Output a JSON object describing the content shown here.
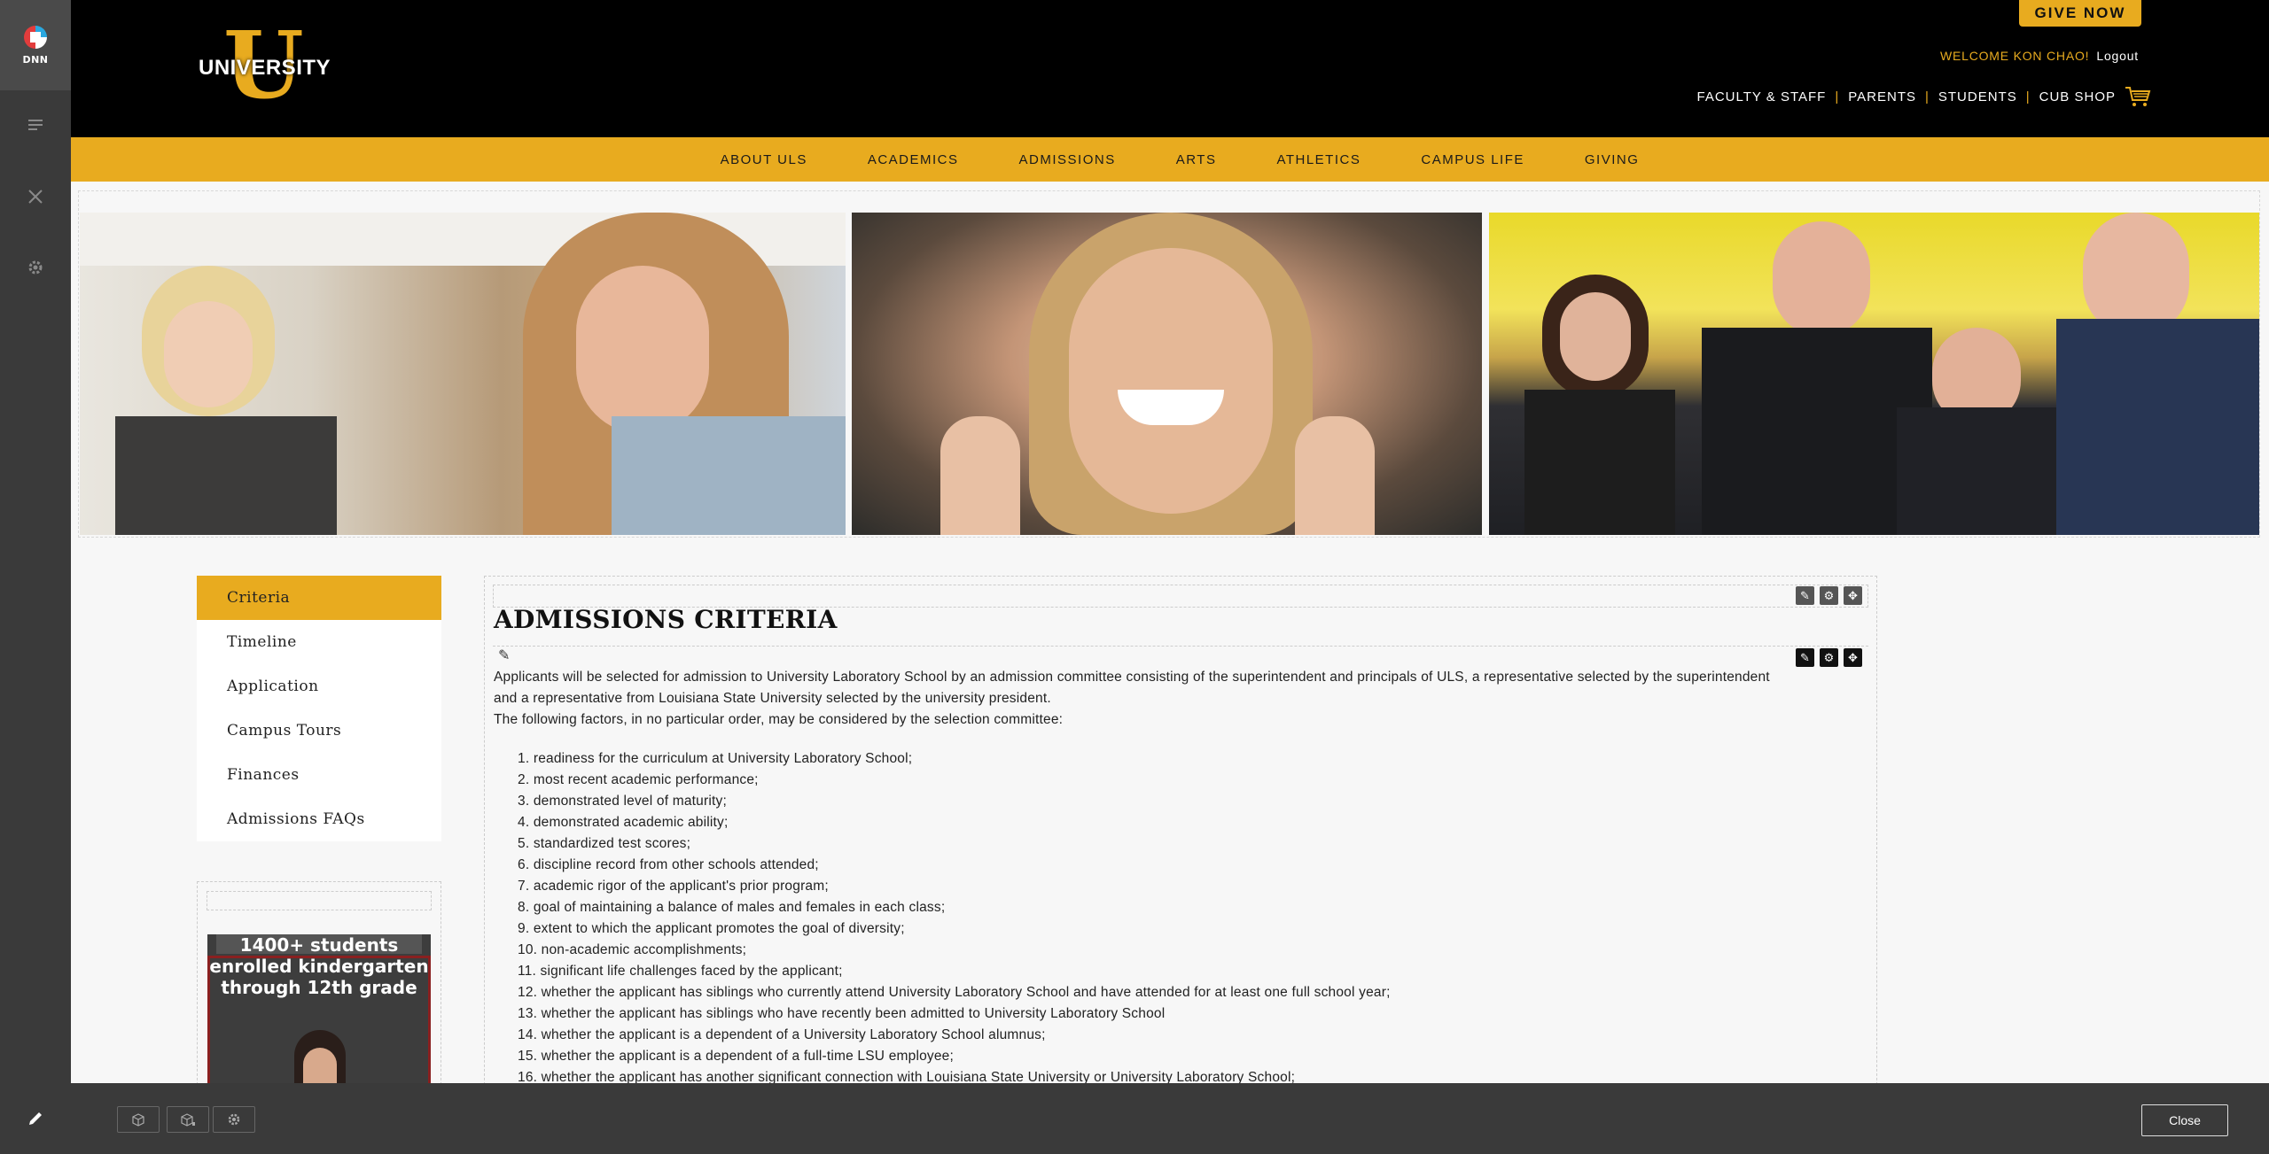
{
  "header": {
    "give_now": "GIVE NOW",
    "welcome": "WELCOME KON CHAO!",
    "logout": "Logout",
    "logo_word": "UNIVERSITY",
    "logo_letter": "U",
    "top_links": [
      "FACULTY & STAFF",
      "PARENTS",
      "STUDENTS",
      "CUB SHOP"
    ]
  },
  "main_nav": [
    "ABOUT ULS",
    "ACADEMICS",
    "ADMISSIONS",
    "ARTS",
    "ATHLETICS",
    "CAMPUS LIFE",
    "GIVING"
  ],
  "left_menu": {
    "items": [
      "Criteria",
      "Timeline",
      "Application",
      "Campus Tours",
      "Finances",
      "Admissions FAQs"
    ],
    "active": "Criteria"
  },
  "promo": {
    "text": "1400+ students enrolled kindergarten through 12th grade"
  },
  "content": {
    "title": "ADMISSIONS CRITERIA",
    "intro_1": "Applicants will be selected for admission to University Laboratory School by an admission committee consisting of the superintendent and principals of ULS, a representative selected by the superintendent and a representative from Louisiana State University selected by the university president.",
    "intro_2": "The following factors, in no particular order, may be considered by the selection committee:",
    "factors": [
      "1. readiness for the curriculum at University Laboratory School;",
      "2. most recent academic performance;",
      "3. demonstrated level of maturity;",
      "4. demonstrated academic ability;",
      "5. standardized test scores;",
      "6. discipline record from other schools attended;",
      "7. academic rigor of the applicant's prior program;",
      "8. goal of maintaining a balance of males and females in each class;",
      "9. extent to which the applicant promotes the goal of diversity;",
      "10. non-academic accomplishments;",
      "11. significant life challenges faced by the applicant;",
      "12. whether the applicant has siblings who currently attend University Laboratory School and have attended for at least one full school year;",
      "13. whether the applicant has siblings who have recently been admitted to University Laboratory School",
      "14. whether the applicant is a dependent of a University Laboratory School alumnus;",
      "15. whether the applicant is a dependent of a full-time LSU employee;",
      "16. whether the applicant has another significant connection with Louisiana State University or University Laboratory School;"
    ]
  },
  "persona_bar": {
    "brand": "DNN"
  },
  "edit_bar": {
    "close": "Close"
  },
  "colors": {
    "gold": "#e8ab1f",
    "black": "#000000",
    "persona": "#3a3a3a"
  }
}
